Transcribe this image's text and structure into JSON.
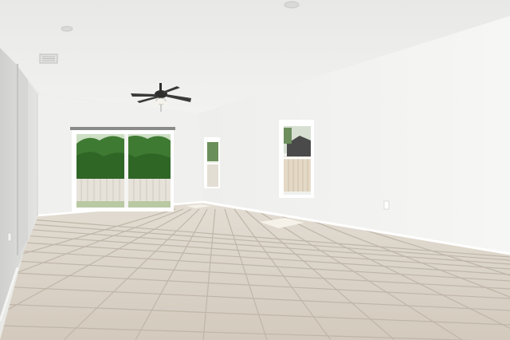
{
  "scene": {
    "kind": "empty-room-interior",
    "elements": [
      "textured-ceiling",
      "ceiling-fan",
      "recessed-light",
      "air-vent",
      "sliding-glass-door",
      "left-window",
      "right-window",
      "tile-floor",
      "baseboard",
      "wall-outlet"
    ]
  },
  "colors": {
    "ceiling": "#ececea",
    "wall_back": "#f1f1ef",
    "wall_right": "#f3f3f1",
    "wall_left": "#dcdcda",
    "floor": "#d8d0c4",
    "floor_grout": "#bcb3a7",
    "trim": "#ffffff",
    "foliage": "#3f7a33",
    "fence": "#e6e2da",
    "fan": "#2e2e2e"
  }
}
